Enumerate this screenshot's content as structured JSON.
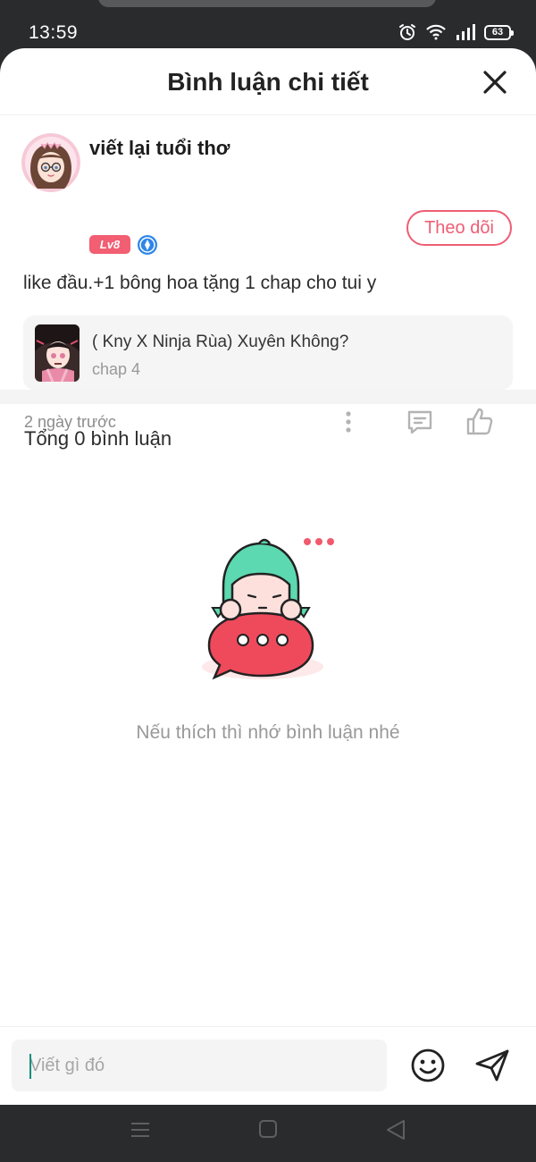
{
  "status": {
    "time": "13:59",
    "battery": "63"
  },
  "header": {
    "title": "Bình luận chi tiết"
  },
  "post": {
    "username": "viết lại tuổi thơ",
    "level": "Lv8",
    "follow_label": "Theo dõi",
    "text": "like đầu.+1 bông hoa tặng 1 chap cho tui y",
    "manga": {
      "title": "( Kny X Ninja Rùa) Xuyên Không?",
      "chapter": "chap 4"
    },
    "time": "2 ngày trước"
  },
  "comments": {
    "total_label": "Tổng 0 bình luận",
    "empty_text": "Nếu thích thì nhớ bình luận nhé"
  },
  "input": {
    "placeholder": "Viết gì đó"
  },
  "colors": {
    "accent": "#ee5e74",
    "level_badge": "#f25e72",
    "vip_badge": "#2f86e8",
    "mascot_hair": "#5cd9b0",
    "mascot_bubble": "#ef4a5c"
  },
  "icons": [
    "close-icon",
    "vip-icon",
    "more-icon",
    "comment-icon",
    "like-icon",
    "emoji-icon",
    "send-icon",
    "alarm-icon",
    "wifi-icon",
    "signal-icon",
    "battery-icon",
    "nav-menu-icon",
    "nav-home-icon",
    "nav-back-icon"
  ]
}
